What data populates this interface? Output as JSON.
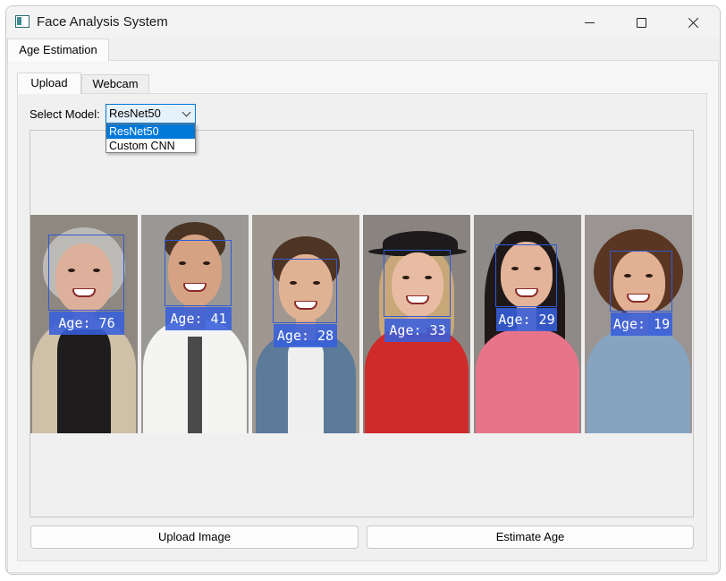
{
  "window": {
    "title": "Face Analysis System"
  },
  "outer_tabs": [
    {
      "label": "Age Estimation",
      "active": true
    }
  ],
  "inner_tabs": [
    {
      "label": "Upload",
      "active": true
    },
    {
      "label": "Webcam",
      "active": false
    }
  ],
  "model": {
    "label": "Select Model:",
    "selected": "ResNet50",
    "options": [
      "ResNet50",
      "Custom CNN"
    ]
  },
  "faces": [
    {
      "label": "Age: 76"
    },
    {
      "label": "Age: 41"
    },
    {
      "label": "Age: 28"
    },
    {
      "label": "Age: 33"
    },
    {
      "label": "Age: 29"
    },
    {
      "label": "Age: 19"
    }
  ],
  "buttons": {
    "upload": "Upload Image",
    "estimate": "Estimate Age"
  },
  "colors": {
    "accent": "#0078d4",
    "box": "#2f59d6",
    "label_bg": "#375fdc"
  }
}
